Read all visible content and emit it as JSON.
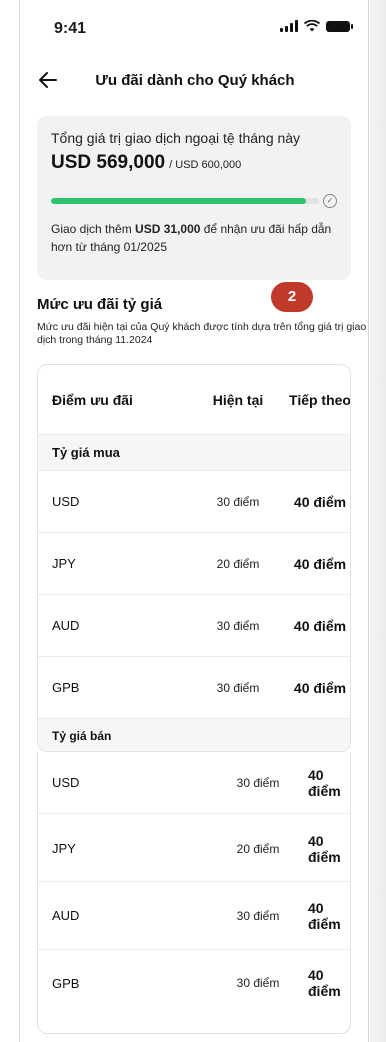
{
  "status_bar": {
    "time": "9:41"
  },
  "nav": {
    "title": "Ưu đãi dành cho Quý khách"
  },
  "summary": {
    "label": "Tổng giá trị giao dịch ngoại tệ tháng này",
    "amount": "USD 569,000",
    "limit": "/ USD 600,000",
    "progress": 0.95,
    "note_prefix": "Giao dịch thêm ",
    "note_amount": "USD 31,000",
    "note_suffix": " để nhận ưu đãi hấp dẫn hơn từ tháng 01/2025"
  },
  "badge": {
    "value": "2",
    "color": "#c0392b"
  },
  "rate_section": {
    "title": "Mức ưu đãi tỷ giá",
    "description": "Mức ưu đãi hiện tại của Quý khách được tính dựa trên tổng giá trị giao dịch trong tháng 11.2024"
  },
  "table": {
    "headers": [
      "Điểm ưu đãi",
      "Hiện tại",
      "Tiếp theo"
    ],
    "groups": [
      {
        "title": "Tỷ giá mua",
        "rows": [
          {
            "currency": "USD",
            "current": "30 điểm",
            "next": "40 điểm"
          },
          {
            "currency": "JPY",
            "current": "20 điểm",
            "next": "40 điểm"
          },
          {
            "currency": "AUD",
            "current": "30 điểm",
            "next": "40 điểm"
          },
          {
            "currency": "GPB",
            "current": "30 điểm",
            "next": "40 điểm"
          }
        ]
      },
      {
        "title": "Tỷ giá bán",
        "rows": [
          {
            "currency": "USD",
            "current": "30 điểm",
            "next": "40 điểm"
          },
          {
            "currency": "JPY",
            "current": "20 điểm",
            "next": "40 điểm"
          },
          {
            "currency": "AUD",
            "current": "30 điểm",
            "next": "40 điểm"
          },
          {
            "currency": "GPB",
            "current": "30 điểm",
            "next": "40 điểm"
          }
        ]
      }
    ]
  },
  "colors": {
    "progress_fill": "#2ec26a",
    "accent": "#c0392b"
  },
  "icons": {
    "back": "arrow-left-icon",
    "signal": "cellular-signal-icon",
    "wifi": "wifi-icon",
    "battery": "battery-icon",
    "check": "check-circle-icon"
  }
}
